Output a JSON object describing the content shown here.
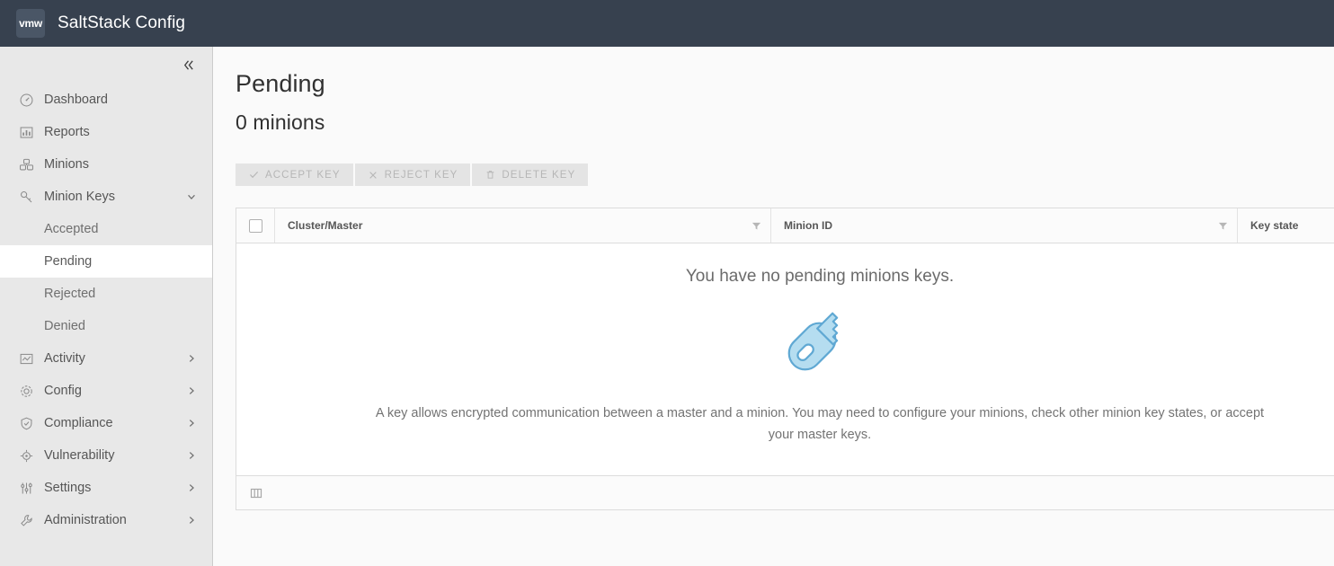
{
  "header": {
    "logo_text": "vmw",
    "app_title": "SaltStack Config"
  },
  "sidebar": {
    "collapse_icon": "double-chevron-left-icon",
    "items": [
      {
        "label": "Dashboard",
        "icon": "speedometer-icon",
        "type": "item"
      },
      {
        "label": "Reports",
        "icon": "bar-chart-icon",
        "type": "item"
      },
      {
        "label": "Minions",
        "icon": "minions-icon",
        "type": "item"
      },
      {
        "label": "Minion Keys",
        "icon": "key-icon",
        "type": "item",
        "chevron": "chevron-down-icon",
        "expanded": true
      }
    ],
    "sub_items": [
      {
        "label": "Accepted",
        "active": false
      },
      {
        "label": "Pending",
        "active": true
      },
      {
        "label": "Rejected",
        "active": false
      },
      {
        "label": "Denied",
        "active": false
      }
    ],
    "items_after": [
      {
        "label": "Activity",
        "icon": "activity-icon",
        "chevron": "chevron-right-icon"
      },
      {
        "label": "Config",
        "icon": "gear-icon",
        "chevron": "chevron-right-icon"
      },
      {
        "label": "Compliance",
        "icon": "shield-icon",
        "chevron": "chevron-right-icon"
      },
      {
        "label": "Vulnerability",
        "icon": "target-icon",
        "chevron": "chevron-right-icon"
      },
      {
        "label": "Settings",
        "icon": "sliders-icon",
        "chevron": "chevron-right-icon"
      },
      {
        "label": "Administration",
        "icon": "wrench-icon",
        "chevron": "chevron-right-icon"
      }
    ]
  },
  "main": {
    "title": "Pending",
    "subtitle": "0 minions",
    "toolbar": [
      {
        "label": "Accept Key",
        "icon": "check-icon",
        "disabled": true
      },
      {
        "label": "Reject Key",
        "icon": "close-icon",
        "disabled": true
      },
      {
        "label": "Delete Key",
        "icon": "trash-icon",
        "disabled": true
      }
    ],
    "table": {
      "columns": [
        {
          "label": "Cluster/Master",
          "filter": "filter-icon"
        },
        {
          "label": "Minion ID",
          "filter": "filter-icon"
        },
        {
          "label": "Key state",
          "filter": null
        }
      ],
      "rows": [],
      "empty_state": {
        "heading": "You have no pending minions keys.",
        "illustration": "key-illustration",
        "description": "A key allows encrypted communication between a master and a minion. You may need to configure your minions, check other minion key states, or accept your master keys."
      },
      "footer_icon": "column-settings-icon"
    }
  },
  "colors": {
    "header_bg": "#37414f",
    "sidebar_bg": "#e8e8e8",
    "active_bg": "#ffffff",
    "key_fill": "#b5ddf0",
    "key_stroke": "#5fa8d3"
  }
}
